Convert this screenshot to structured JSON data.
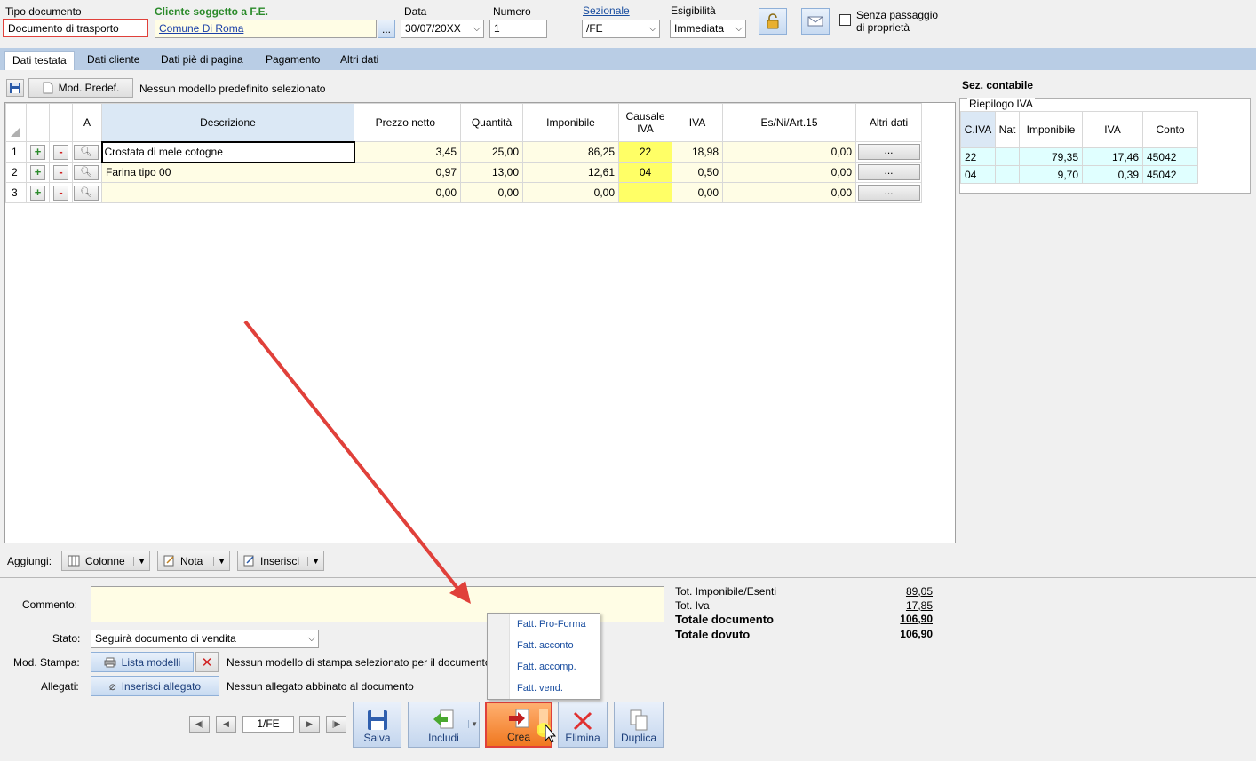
{
  "header": {
    "tipo_label": "Tipo documento",
    "tipo_value": "Documento di trasporto",
    "cliente_label": "Cliente soggetto a F.E.",
    "cliente_value": "Comune Di Roma",
    "cliente_btn": "...",
    "data_label": "Data",
    "data_value": "30/07/20XX",
    "numero_label": "Numero",
    "numero_value": "1",
    "sezionale_label": "Sezionale",
    "sezionale_value": "/FE",
    "esigibilita_label": "Esigibilità",
    "esigibilita_value": "Immediata",
    "senza_line1": "Senza passaggio",
    "senza_line2": "di proprietà"
  },
  "tabs": [
    "Dati testata",
    "Dati cliente",
    "Dati piè di pagina",
    "Pagamento",
    "Altri dati"
  ],
  "toolbar": {
    "mod_predef": "Mod. Predef.",
    "nessun_modello": "Nessun modello predefinito selezionato"
  },
  "grid": {
    "headers": {
      "a": "A",
      "descrizione": "Descrizione",
      "prezzo": "Prezzo netto",
      "quantita": "Quantità",
      "imponibile": "Imponibile",
      "causale1": "Causale",
      "causale2": "IVA",
      "iva": "IVA",
      "esni": "Es/Ni/Art.15",
      "altri": "Altri dati"
    },
    "rows": [
      {
        "n": "1",
        "desc": "Crostata di mele cotogne",
        "prezzo": "3,45",
        "qta": "25,00",
        "imp": "86,25",
        "causale": "22",
        "iva": "18,98",
        "esni": "0,00",
        "altri": "..."
      },
      {
        "n": "2",
        "desc": "Farina tipo 00",
        "prezzo": "0,97",
        "qta": "13,00",
        "imp": "12,61",
        "causale": "04",
        "iva": "0,50",
        "esni": "0,00",
        "altri": "..."
      },
      {
        "n": "3",
        "desc": "",
        "prezzo": "0,00",
        "qta": "0,00",
        "imp": "0,00",
        "causale": "",
        "iva": "0,00",
        "esni": "0,00",
        "altri": "..."
      }
    ],
    "plus": "+",
    "minus": "-"
  },
  "side": {
    "title": "Sez. contabile",
    "group": "Riepilogo IVA",
    "headers": {
      "civa": "C.IVA",
      "nat": "Nat",
      "imp": "Imponibile",
      "iva": "IVA",
      "conto": "Conto"
    },
    "rows": [
      {
        "civa": "22",
        "nat": "",
        "imp": "79,35",
        "iva": "17,46",
        "conto": "45042"
      },
      {
        "civa": "04",
        "nat": "",
        "imp": "9,70",
        "iva": "0,39",
        "conto": "45042"
      }
    ]
  },
  "aggiungi": {
    "label": "Aggiungi:",
    "colonne": "Colonne",
    "nota": "Nota",
    "inserisci": "Inserisci"
  },
  "bottom": {
    "commento_label": "Commento:",
    "stato_label": "Stato:",
    "stato_value": "Seguirà documento di vendita",
    "modstampa_label": "Mod. Stampa:",
    "lista_modelli": "Lista modelli",
    "nessun_stampa": "Nessun modello di stampa selezionato per il documento",
    "allegati_label": "Allegati:",
    "inserisci_allegato": "Inserisci allegato",
    "nessun_allegato": "Nessun allegato abbinato al documento",
    "nav_value": "1/FE"
  },
  "totals": [
    {
      "label": "Tot. Imponibile/Esenti",
      "value": "89,05"
    },
    {
      "label": "Tot. Iva",
      "value": "17,85"
    },
    {
      "label": "Totale documento",
      "value": "106,90"
    },
    {
      "label": "Totale dovuto",
      "value": "106,90"
    }
  ],
  "popup": [
    "Fatt. Pro-Forma",
    "Fatt. acconto",
    "Fatt. accomp.",
    "Fatt. vend."
  ],
  "actions": {
    "salva": "Salva",
    "includi": "Includi",
    "crea": "Crea",
    "elimina": "Elimina",
    "duplica": "Duplica"
  },
  "colors": {
    "accent_red": "#e0403a",
    "highlight_yellow": "#ffff66",
    "tab_bar": "#b9cde5"
  }
}
